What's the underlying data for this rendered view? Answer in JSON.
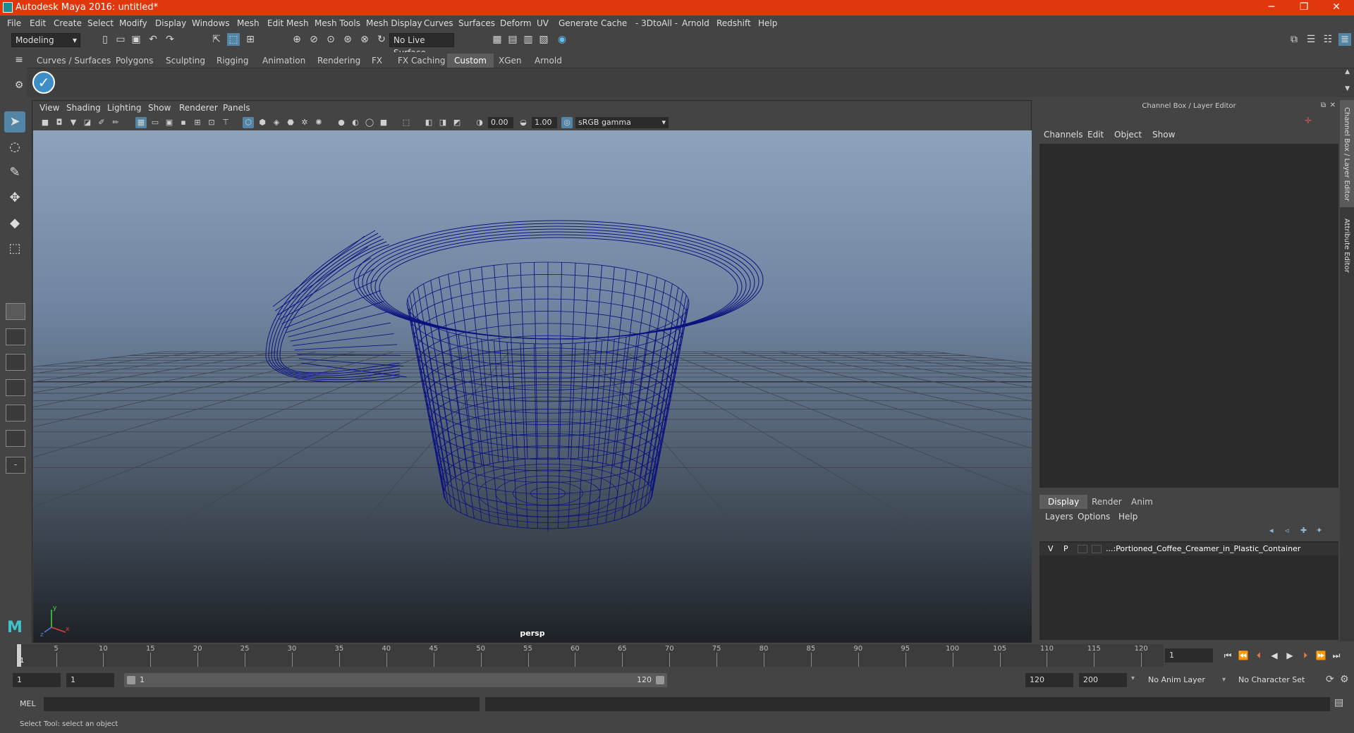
{
  "window": {
    "title": "Autodesk Maya 2016: untitled*",
    "accent": "#e0370c",
    "controls": [
      "─",
      "❐",
      "✕"
    ]
  },
  "menubar": [
    "File",
    "Edit",
    "Create",
    "Select",
    "Modify",
    "Display",
    "Windows",
    "Mesh",
    "Edit Mesh",
    "Mesh Tools",
    "Mesh Display",
    "Curves",
    "Surfaces",
    "Deform",
    "UV",
    "Generate",
    "Cache",
    "- 3DtoAll -",
    "Arnold",
    "Redshift",
    "Help"
  ],
  "statusline": {
    "mode": "Modeling",
    "live_surface": "No Live Surface"
  },
  "shelf": {
    "tabs": [
      "Curves / Surfaces",
      "Polygons",
      "Sculpting",
      "Rigging",
      "Animation",
      "Rendering",
      "FX",
      "FX Caching",
      "Custom",
      "XGen",
      "Arnold"
    ],
    "active_tab": "Custom"
  },
  "viewport": {
    "menu": [
      "View",
      "Shading",
      "Lighting",
      "Show",
      "Renderer",
      "Panels"
    ],
    "exposure": "0.00",
    "gamma": "1.00",
    "color_space": "sRGB gamma",
    "camera": "persp",
    "axis_labels": [
      "y",
      "x",
      "z"
    ],
    "wire_color": "#0c1280"
  },
  "channelbox": {
    "header": "Channel Box / Layer Editor",
    "menu": [
      "Channels",
      "Edit",
      "Object",
      "Show"
    ],
    "layer_tabs": [
      "Display",
      "Render",
      "Anim"
    ],
    "active_layer_tab": "Display",
    "layer_menu": [
      "Layers",
      "Options",
      "Help"
    ],
    "layer": {
      "v": "V",
      "p": "P",
      "name": "...:Portioned_Coffee_Creamer_in_Plastic_Container"
    },
    "side_tabs": [
      "Channel Box / Layer Editor",
      "Attribute Editor"
    ]
  },
  "timeline": {
    "labels": [
      "5",
      "10",
      "15",
      "20",
      "25",
      "30",
      "35",
      "40",
      "45",
      "50",
      "55",
      "60",
      "65",
      "70",
      "75",
      "80",
      "85",
      "90",
      "95",
      "100",
      "105",
      "110",
      "115",
      "120"
    ],
    "start_label": "1",
    "current_frame": "1"
  },
  "range": {
    "start": "1",
    "playback_start": "1",
    "slider_start": "1",
    "slider_end": "120",
    "playback_end": "120",
    "end": "200",
    "anim_layer": "No Anim Layer",
    "character_set": "No Character Set"
  },
  "cmdline": {
    "label": "MEL"
  },
  "helpline": "Select Tool: select an object"
}
